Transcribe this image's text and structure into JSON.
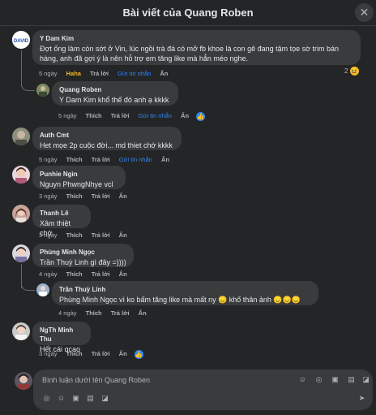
{
  "header": {
    "title": "Bài viết của Quang Roben",
    "close_glyph": "✕"
  },
  "comments": [
    {
      "name": "Y Dam Kim",
      "text": "Đợt ống làm còn sớt ở Vin, lúc ngồi trà đá có mở fb khoe là con gê đang tậm tọe sờ trim bán hàng, anh đã gợi ý là nên hỗ trợ em tăng like mà hẳn méo nghe.",
      "time": "5 ngày",
      "like": "Haha",
      "reply": "Trả lời",
      "dm": "Gửi tin nhắn",
      "hide": "Ẩn",
      "react_count": "2"
    },
    {
      "name": "Quang Roben",
      "text": "Y Dam Kim khổ thế đó anh ạ kkkk",
      "time": "5 ngày",
      "like": "Thích",
      "reply": "Trả lời",
      "dm": "Gửi tin nhắn",
      "hide": "Ẩn"
    },
    {
      "name": "Auth Cmt",
      "text": "Het mọe 2p cuộc đời... md thiet chớ kkkk",
      "time": "5 ngày",
      "like": "Thích",
      "reply": "Trả lời",
      "dm": "Gửi tin nhắn",
      "hide": "Ẩn"
    },
    {
      "name": "Punhie Ngìn",
      "text": "Nguyn PhwngNhye vcl",
      "time": "3 ngày",
      "like": "Thích",
      "reply": "Trả lời",
      "hide": "Ẩn"
    },
    {
      "name": "Thanh Lê",
      "text": "Xâm thiệt chớ",
      "time": "3 ngày",
      "like": "Thích",
      "reply": "Trả lời",
      "hide": "Ẩn"
    },
    {
      "name": "Phùng Minh Ngọc",
      "text": "Trần Thuỳ Linh gì đây =))))",
      "time": "4 ngày",
      "like": "Thích",
      "reply": "Trả lời",
      "hide": "Ẩn"
    },
    {
      "name": "Trần Thuỳ Linh",
      "text": "Phùng Minh Ngọc vì ko bấm tăng like mà mất ny 😞 khổ thân ảnh 😞😞😞",
      "time": "4 ngày",
      "like": "Thích",
      "reply": "Trả lời",
      "hide": "Ẩn"
    },
    {
      "name": "NgTh Minh Thu",
      "text": "Hết cái qcao",
      "time": "3 ngày",
      "like": "Thích",
      "reply": "Trả lời",
      "hide": "Ẩn"
    }
  ],
  "composer": {
    "placeholder": "Bình luận dưới tên Quang Roben"
  },
  "colors": {
    "accent": "#2d88ff",
    "haha": "#f7b928",
    "background": "#242526",
    "bubble": "#3a3b3c"
  }
}
